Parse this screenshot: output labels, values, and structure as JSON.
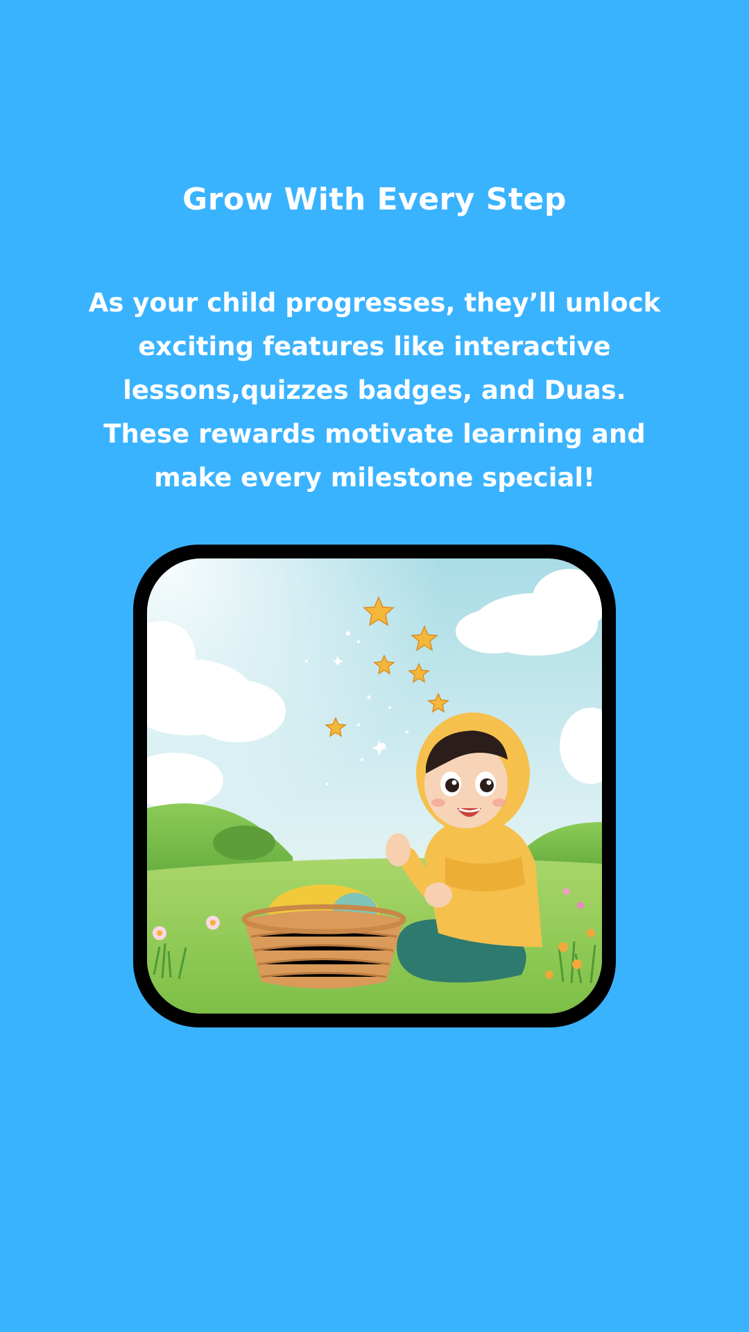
{
  "onboarding": {
    "title": "Grow With Every Step",
    "description": "As your child progresses, they’ll unlock exciting features like interactive lessons,quizzes badges, and Duas. These rewards motivate learning and make every milestone special!",
    "illustration": {
      "icon": "girl-with-basket-and-stars-illustration"
    }
  },
  "colors": {
    "background": "#3AB3FF",
    "text": "#FFFFFF",
    "frame": "#000000",
    "star": "#F5B73A",
    "hijab": "#F6C04D"
  }
}
